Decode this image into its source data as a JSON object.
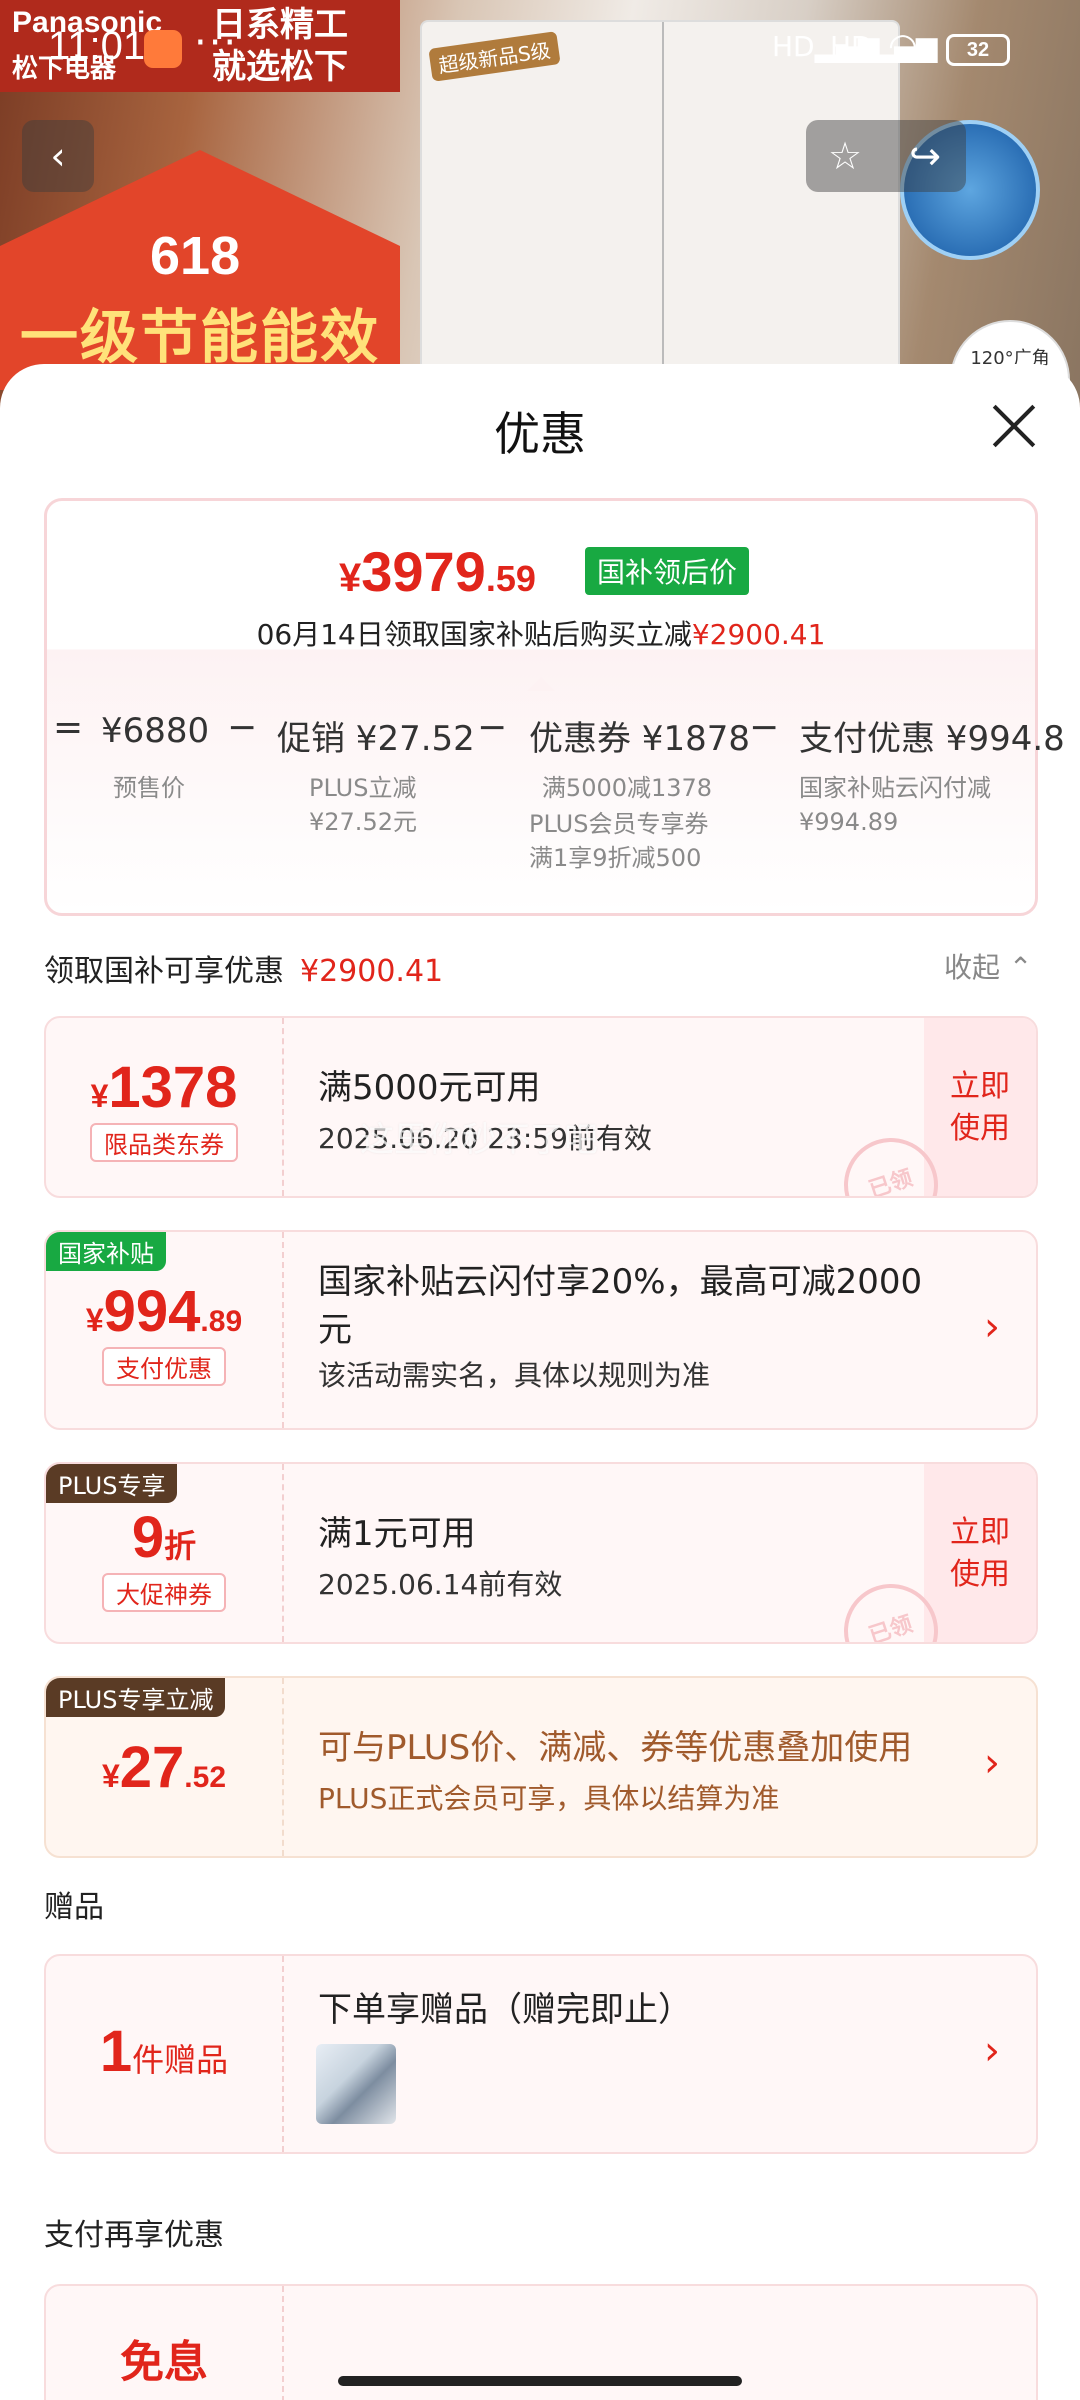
{
  "status_bar": {
    "time": "11:01",
    "dots": "···",
    "signal_1": "HD",
    "signal_2": "HD",
    "battery": "32"
  },
  "background": {
    "brand": "Panasonic",
    "brand_cn": "松下电器",
    "slogan_line1": "日系精工",
    "slogan_line2": "就选松下",
    "promo_618": "618",
    "promo_line": "一级节能能效",
    "fridge_badge": "超级新品S级",
    "wide_label": "120°广角"
  },
  "sheet": {
    "title": "优惠",
    "summary": {
      "currency": "¥",
      "price_int": "3979",
      "price_dec": ".59",
      "price_tag": "国补领后价",
      "subtitle_prefix": "06月14日领取国家补贴后购买立减",
      "subtitle_amount": "¥2900.41",
      "calc": [
        {
          "op": "=",
          "value": "¥6880",
          "notes": [
            "预售价"
          ]
        },
        {
          "op": "−",
          "value": "促销 ¥27.52",
          "notes": [
            "PLUS立减",
            "¥27.52元"
          ]
        },
        {
          "op": "−",
          "value": "优惠券 ¥1878",
          "notes": [
            "满5000减1378",
            "PLUS会员专享券",
            "满1享9折减500"
          ]
        },
        {
          "op": "−",
          "value": "支付优惠 ¥994.8",
          "notes": [
            "国家补贴云闪付减",
            "¥994.89"
          ]
        }
      ]
    },
    "subsidy_section": {
      "label": "领取国补可享优惠",
      "amount": "¥2900.41",
      "collapse": "收起"
    },
    "coupons": [
      {
        "currency": "¥",
        "amount": "1378",
        "decimal": "",
        "type": "限品类东券",
        "line1": "满5000元可用",
        "line2": "2025.06.20 23:59前有效",
        "cta": "立即使用",
        "stamp": "已领"
      },
      {
        "ribbon": "国家补贴",
        "currency": "¥",
        "amount": "994",
        "decimal": ".89",
        "type": "支付优惠",
        "line1": "国家补贴云闪付享20%，最高可减2000元",
        "line2": "该活动需实名，具体以规则为准",
        "arrow": "›"
      },
      {
        "ribbon": "PLUS专享",
        "amount": "9",
        "unit": "折",
        "type": "大促神券",
        "line1": "满1元可用",
        "line2": "2025.06.14前有效",
        "cta": "立即使用",
        "stamp": "已领"
      },
      {
        "ribbon": "PLUS专享立减",
        "currency": "¥",
        "amount": "27",
        "decimal": ".52",
        "line1": "可与PLUS价、满减、券等优惠叠加使用",
        "line2": "PLUS正式会员可享，具体以结算为准",
        "arrow": "›"
      }
    ],
    "watermark": "这里你秒不了吧",
    "gift_section": {
      "label": "赠品",
      "count": "1",
      "unit": "件赠品",
      "line1": "下单享赠品（赠完即止）",
      "arrow": "›"
    },
    "pay_section": {
      "label": "支付再享优惠",
      "partial": "免息"
    }
  },
  "colors": {
    "accent": "#e1251b",
    "green_tag": "#18a942",
    "plus_brown": "#5a3b25"
  }
}
